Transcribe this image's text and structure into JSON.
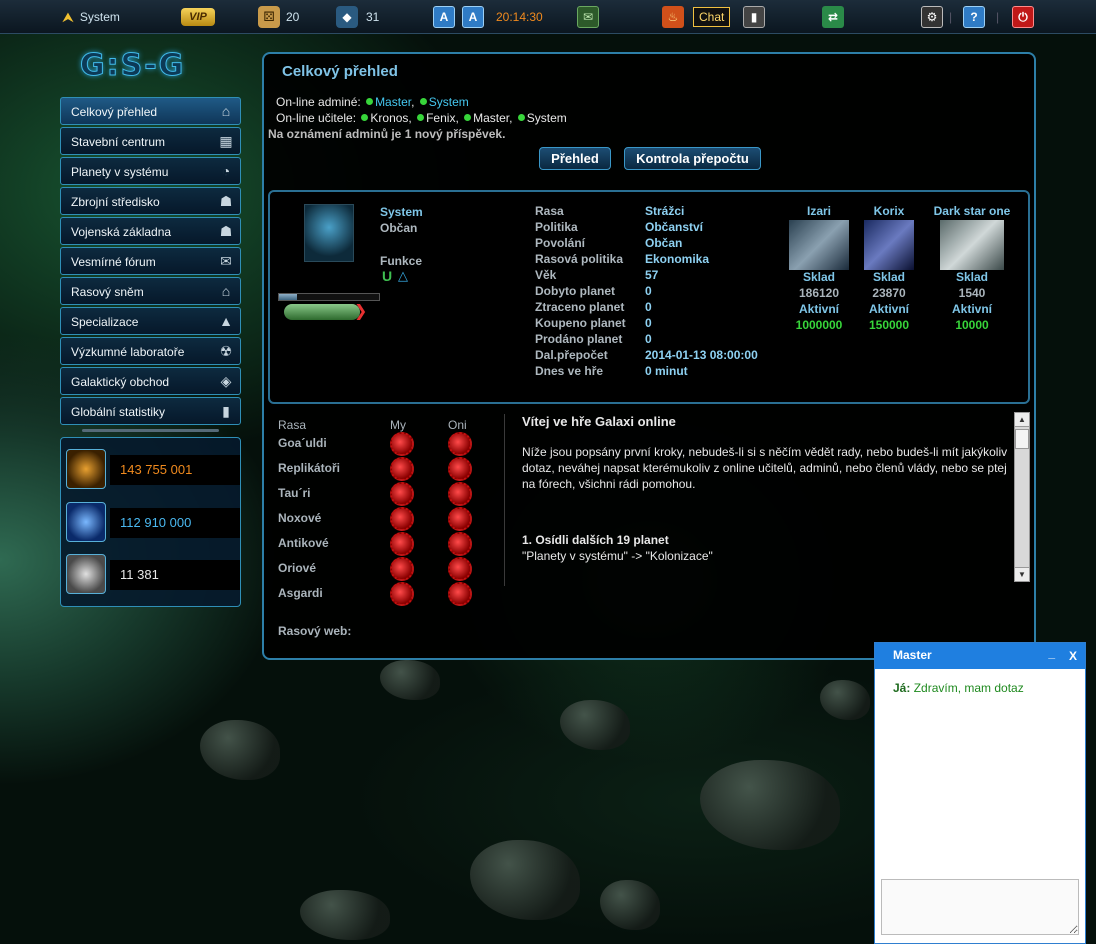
{
  "topbar": {
    "username": "System",
    "vip_label": "VIP",
    "dice_count": "20",
    "fleet_count": "31",
    "clock": "20:14:30",
    "chat_label": "Chat"
  },
  "logo": {
    "text": "G:S-G"
  },
  "menu": {
    "items": [
      {
        "label": "Celkový přehled",
        "icon": "home-icon",
        "glyph": "⌂"
      },
      {
        "label": "Stavební centrum",
        "icon": "building-icon",
        "glyph": "▦"
      },
      {
        "label": "Planety v systému",
        "icon": "planet-icon",
        "glyph": "◔"
      },
      {
        "label": "Zbrojní středisko",
        "icon": "soldier-icon",
        "glyph": "☗"
      },
      {
        "label": "Vojenská základna",
        "icon": "base-icon",
        "glyph": "☗"
      },
      {
        "label": "Vesmírné fórum",
        "icon": "forum-icon",
        "glyph": "✉"
      },
      {
        "label": "Rasový sněm",
        "icon": "parliament-icon",
        "glyph": "⌂"
      },
      {
        "label": "Specializace",
        "icon": "specialization-icon",
        "glyph": "▲"
      },
      {
        "label": "Výzkumné laboratoře",
        "icon": "radiation-icon",
        "glyph": "☢"
      },
      {
        "label": "Galaktický obchod",
        "icon": "trade-icon",
        "glyph": "◈"
      },
      {
        "label": "Globální statistiky",
        "icon": "stats-icon",
        "glyph": "▮"
      }
    ]
  },
  "resources": [
    {
      "value": "143 755 001",
      "color": "#f08a1e",
      "icon": "ore-icon"
    },
    {
      "value": "112 910 000",
      "color": "#4ab8f0",
      "icon": "energy-icon"
    },
    {
      "value": "11 381",
      "color": "#e8e8e8",
      "icon": "crystal-icon"
    }
  ],
  "main": {
    "title": "Celkový přehled",
    "admins_label": "On-line adminé:",
    "admins": [
      "Master",
      "System"
    ],
    "teachers_label": "On-line učitele:",
    "teachers": [
      "Kronos",
      "Fenix",
      "Master",
      "System"
    ],
    "notice": "Na oznámení adminů je 1 nový příspěvek.",
    "btn_overview": "Přehled",
    "btn_check": "Kontrola přepočtu"
  },
  "profile": {
    "name": "System",
    "role": "Občan",
    "funkce_label": "Funkce",
    "progress_fraction": 0.18,
    "stats": [
      {
        "label": "Rasa",
        "value": "Strážci"
      },
      {
        "label": "Politika",
        "value": "Občanství"
      },
      {
        "label": "Povolání",
        "value": "Občan"
      },
      {
        "label": "Rasová politika",
        "value": "Ekonomika"
      },
      {
        "label": "Věk",
        "value": "57"
      },
      {
        "label": "Dobyto planet",
        "value": "0"
      },
      {
        "label": "Ztraceno planet",
        "value": "0"
      },
      {
        "label": "Koupeno planet",
        "value": "0"
      },
      {
        "label": "Prodáno planet",
        "value": "0"
      },
      {
        "label": "Dal.přepočet",
        "value": "2014-01-13 08:00:00"
      },
      {
        "label": "Dnes ve hře",
        "value": "0 minut"
      }
    ],
    "ships": [
      {
        "name": "Izari",
        "sklad_label": "Sklad",
        "sklad": "186120",
        "aktivni_label": "Aktivní",
        "aktivni": "1000000"
      },
      {
        "name": "Korix",
        "sklad_label": "Sklad",
        "sklad": "23870",
        "aktivni_label": "Aktivní",
        "aktivni": "150000"
      },
      {
        "name": "Dark star one",
        "sklad_label": "Sklad",
        "sklad": "1540",
        "aktivni_label": "Aktivní",
        "aktivni": "10000"
      }
    ]
  },
  "races": {
    "header": {
      "rasa": "Rasa",
      "my": "My",
      "oni": "Oni"
    },
    "list": [
      "Goa´uldi",
      "Replikátoři",
      "Tau´ri",
      "Noxové",
      "Antikové",
      "Oriové",
      "Asgardi"
    ],
    "web_label": "Rasový web:"
  },
  "welcome": {
    "title": "Vítej ve hře Galaxi online",
    "para": "Níže jsou popsány první kroky, nebudeš-li si s něčím vědět rady, nebo budeš-li mít jakýkoliv dotaz, neváhej napsat kterémukoliv z online učitelů, adminů, nebo členů vlády, nebo se ptej na fórech, všichni rádi pomohou.",
    "step_title": "1. Osídli dalších 19 planet",
    "step_text": "\"Planety v systému\" -> \"Kolonizace\""
  },
  "chat": {
    "title": "Master",
    "min": "_",
    "close": "X",
    "msg_author": "Já:",
    "msg_text": "Zdravím, mam dotaz"
  }
}
